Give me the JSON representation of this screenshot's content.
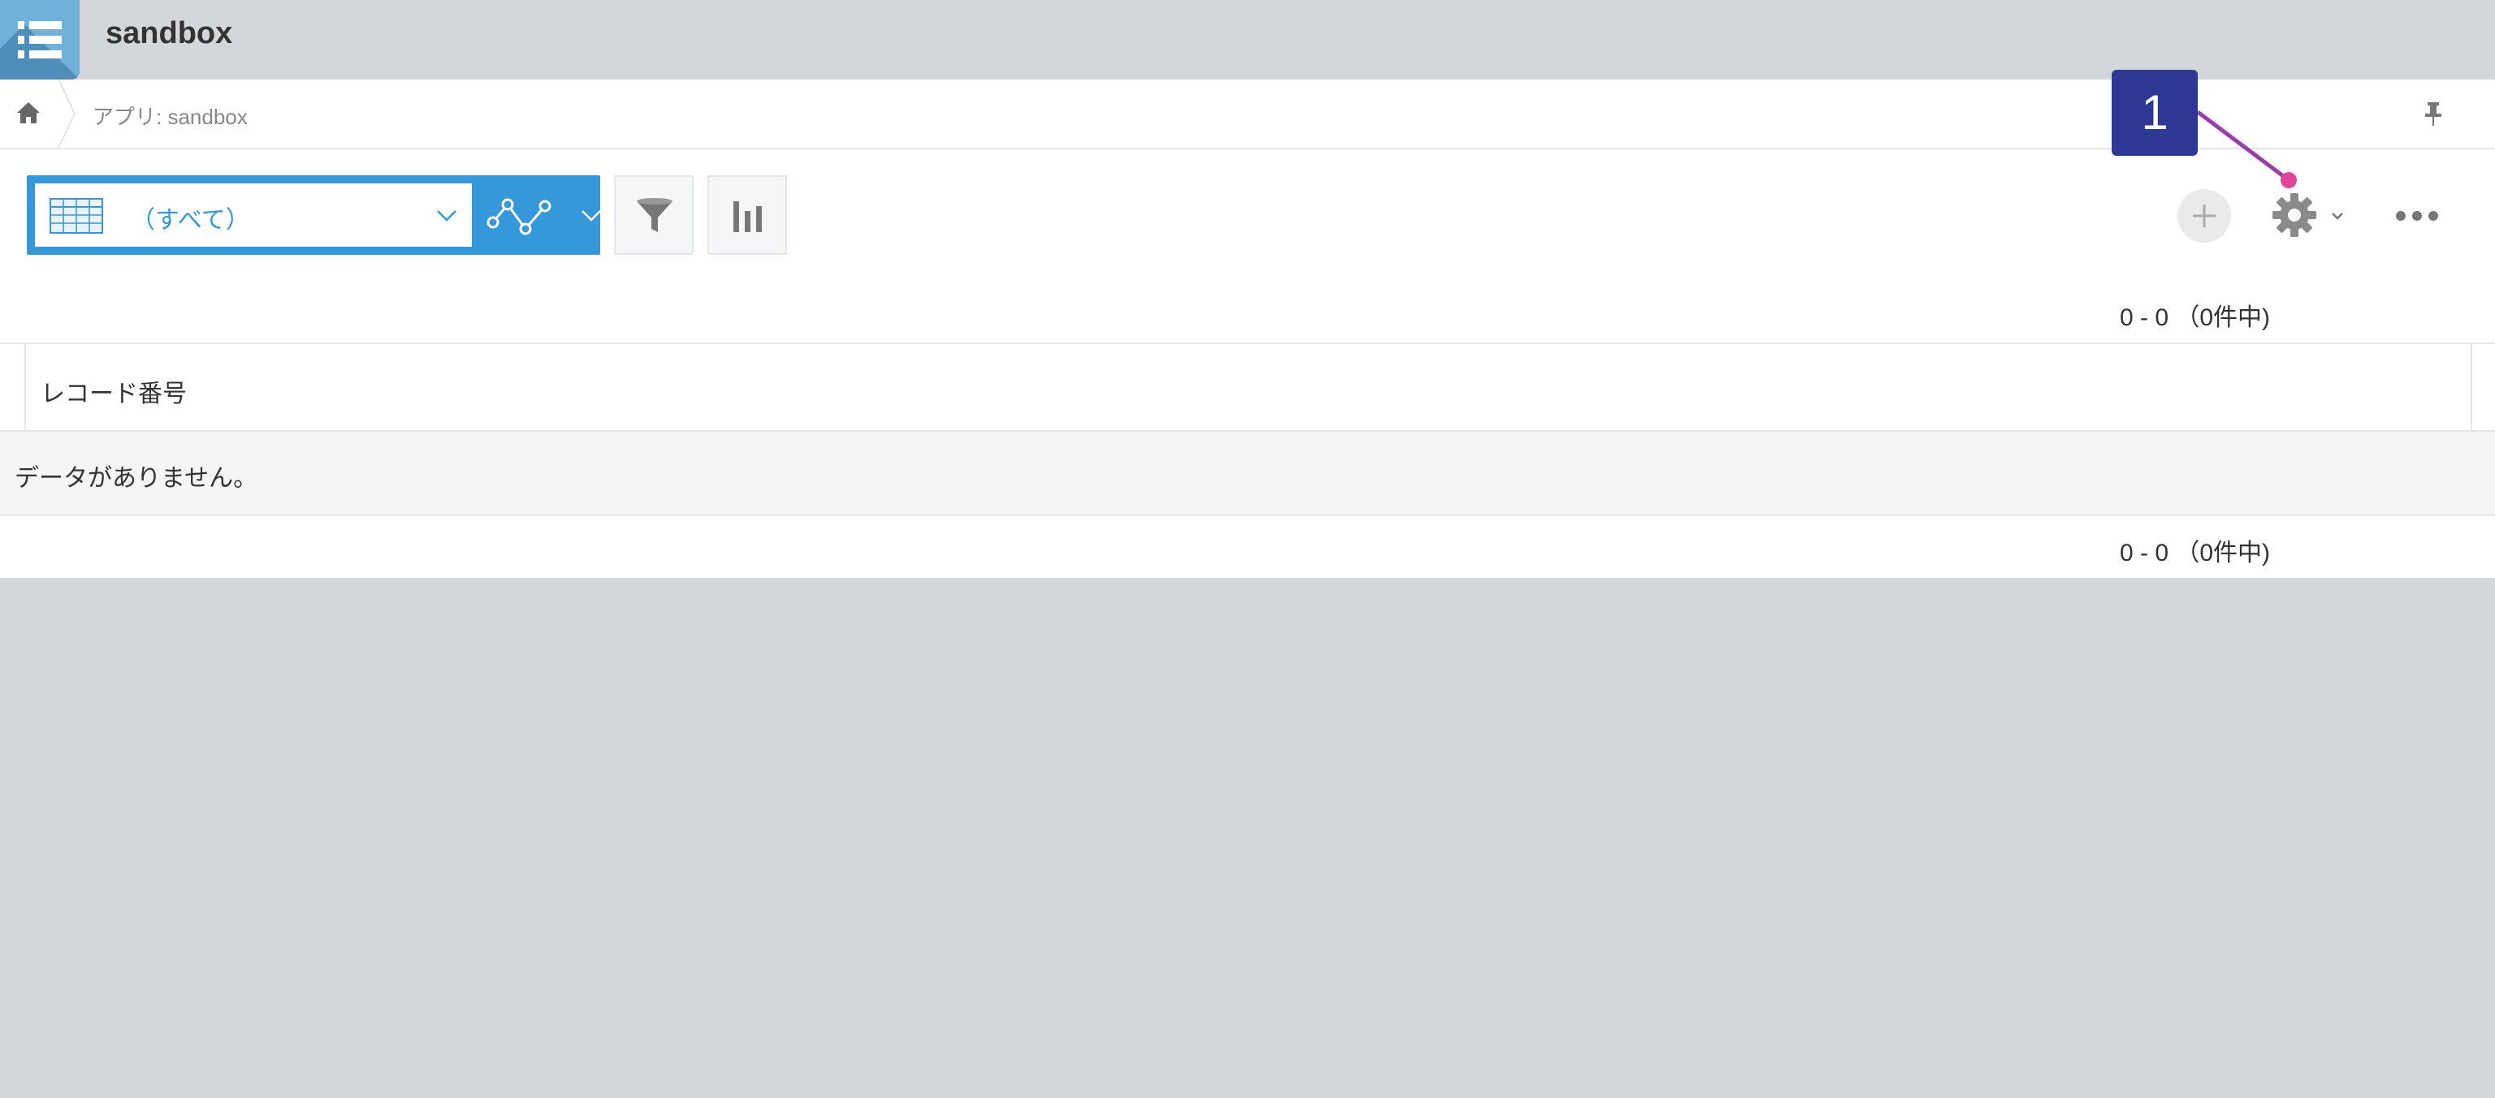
{
  "app": {
    "title": "sandbox"
  },
  "breadcrumb": {
    "current": "アプリ: sandbox"
  },
  "toolbar": {
    "view_label": "（すべて）",
    "add_icon": "plus-icon",
    "settings_icon": "gear-icon",
    "more_icon": "more-icon"
  },
  "pager": {
    "top": "0 - 0 （0件中)",
    "bottom": "0 - 0 （0件中)"
  },
  "table": {
    "columns": [
      "レコード番号"
    ],
    "empty_message": "データがありません。"
  },
  "annotation": {
    "number": "1"
  },
  "colors": {
    "accent": "#3498db",
    "callout": "#2d3895",
    "callout_line": "#9b3fb0",
    "callout_dot": "#e0459a"
  }
}
